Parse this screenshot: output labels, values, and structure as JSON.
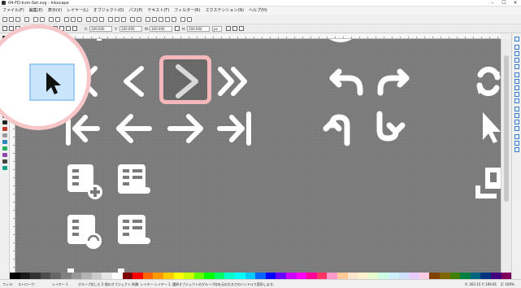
{
  "window": {
    "title": "04-FD-Icon-Set.svg - Inkscape",
    "minimize": "–",
    "maximize": "☐",
    "close": "✕"
  },
  "menu": [
    "ファイル(F)",
    "編集(E)",
    "表示(V)",
    "レイヤー(L)",
    "オブジェクト(O)",
    "パス(P)",
    "テキスト(T)",
    "フィルター(R)",
    "エクステンション(N)",
    "ヘルプ(H)"
  ],
  "controls": {
    "x_label": "X:",
    "x_value": "100.000",
    "y_label": "Y:",
    "y_value": "100.000",
    "w_label": "W:",
    "w_value": "100.000",
    "h_label": "H:",
    "h_value": "100.000",
    "unit": "px"
  },
  "status": {
    "fill_label": "フィル:",
    "stroke_label": "ストローク:",
    "layer": "レイヤー 1",
    "message": "グループ化した 5 個のオブジェクト 所属: レイヤー レイヤー 1. 選択オブジェクトのグループ化を元の大きさのハンドルで変形します。",
    "coords": "X: 263.15  Y: 109.81",
    "zoom": "Z: 100%"
  },
  "palette": [
    "#000000",
    "#1a1a1a",
    "#333333",
    "#4d4d4d",
    "#666666",
    "#808080",
    "#999999",
    "#b3b3b3",
    "#cccccc",
    "#e6e6e6",
    "#ffffff",
    "#800000",
    "#ff0000",
    "#ff6600",
    "#ff9900",
    "#ffcc00",
    "#ffff00",
    "#ccff00",
    "#66ff00",
    "#00ff00",
    "#00ff66",
    "#00ffcc",
    "#00ffff",
    "#00ccff",
    "#0066ff",
    "#0000ff",
    "#6600ff",
    "#cc00ff",
    "#ff00ff",
    "#ff0099",
    "#ff3366",
    "#ff99cc",
    "#ffcc99",
    "#ffe6cc",
    "#fff2cc",
    "#e6ffcc",
    "#ccffe6",
    "#ccf2ff",
    "#cce0ff",
    "#e6ccff",
    "#ffcce6",
    "#804000",
    "#806600",
    "#408000",
    "#008040",
    "#006680",
    "#003380",
    "#400080",
    "#800060"
  ],
  "colors": {
    "canvas": "#7b7b7b",
    "highlight": "#f4b7ba",
    "selection": "#c9e4fb"
  },
  "icons": [
    "double-chevron-left-icon",
    "chevron-left-icon",
    "chevron-right-icon",
    "double-chevron-right-icon",
    "skip-back-icon",
    "arrow-left-icon",
    "arrow-right-icon",
    "skip-forward-icon",
    "undo-icon",
    "redo-icon",
    "refresh-icon",
    "turn-up-icon",
    "turn-down-icon",
    "cursor-icon",
    "database-add-icon",
    "database-remove-icon",
    "database-refresh-icon",
    "database-minus-icon",
    "group-bracket-icon"
  ]
}
